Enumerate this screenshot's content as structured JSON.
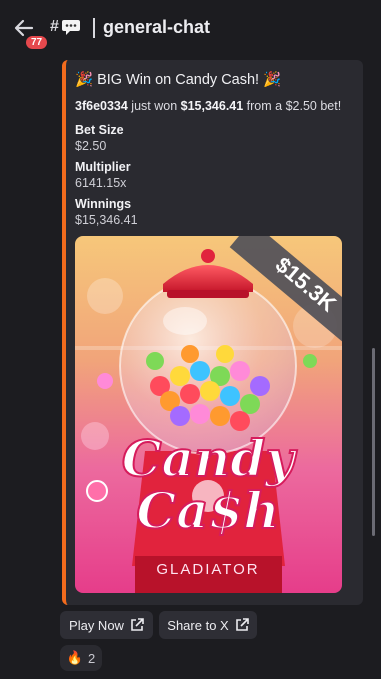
{
  "header": {
    "notification_count": "77",
    "channel_name": "general-chat"
  },
  "embed": {
    "title": "🎉 BIG Win on Candy Cash! 🎉",
    "desc_user": "3f6e0334",
    "desc_mid": " just won ",
    "desc_amount": "$15,346.41",
    "desc_end": " from a $2.50 bet!",
    "fields": [
      {
        "name": "Bet Size",
        "value": "$2.50"
      },
      {
        "name": "Multiplier",
        "value": "6141.15x"
      },
      {
        "name": "Winnings",
        "value": "$15,346.41"
      }
    ],
    "image": {
      "ribbon": "$15.3K",
      "game_line1": "Candy",
      "game_line2": "Ca$h",
      "provider": "GLADIATOR"
    }
  },
  "buttons": {
    "play_now": "Play Now",
    "share_x": "Share to X"
  },
  "reaction": {
    "emoji": "🔥",
    "count": "2"
  }
}
